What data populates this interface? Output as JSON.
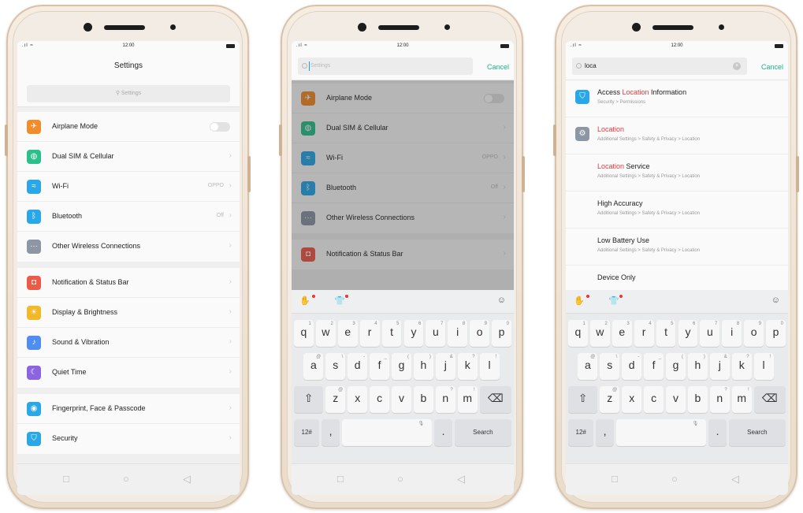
{
  "status": {
    "time": "12:00",
    "signal": ".ıl ≈"
  },
  "screen1": {
    "title": "Settings",
    "search_placeholder": "Settings",
    "groups": [
      [
        {
          "label": "Airplane Mode",
          "icon": "airplane-icon",
          "color": "#f08c2c",
          "glyph": "✈",
          "value": "",
          "control": "toggle"
        },
        {
          "label": "Dual SIM & Cellular",
          "icon": "globe-icon",
          "color": "#2bc08a",
          "glyph": "◍",
          "value": "",
          "control": "chevron"
        },
        {
          "label": "Wi-Fi",
          "icon": "wifi-icon",
          "color": "#2aa7e6",
          "glyph": "≈",
          "value": "OPPO",
          "control": "chevron"
        },
        {
          "label": "Bluetooth",
          "icon": "bluetooth-icon",
          "color": "#2aa7e6",
          "glyph": "ᛒ",
          "value": "Off",
          "control": "chevron"
        },
        {
          "label": "Other Wireless Connections",
          "icon": "more-icon",
          "color": "#8d96a3",
          "glyph": "···",
          "value": "",
          "control": "chevron"
        }
      ],
      [
        {
          "label": "Notification & Status Bar",
          "icon": "notification-icon",
          "color": "#ec5a48",
          "glyph": "◘",
          "value": "",
          "control": "chevron"
        },
        {
          "label": "Display & Brightness",
          "icon": "brightness-icon",
          "color": "#f2b827",
          "glyph": "☀",
          "value": "",
          "control": "chevron"
        },
        {
          "label": "Sound & Vibration",
          "icon": "sound-icon",
          "color": "#4f8ef0",
          "glyph": "♪",
          "value": "",
          "control": "chevron"
        },
        {
          "label": "Quiet Time",
          "icon": "moon-icon",
          "color": "#8c63e0",
          "glyph": "☾",
          "value": "",
          "control": "chevron"
        }
      ],
      [
        {
          "label": "Fingerprint, Face & Passcode",
          "icon": "fingerprint-icon",
          "color": "#2aa7e6",
          "glyph": "◉",
          "value": "",
          "control": "chevron"
        },
        {
          "label": "Security",
          "icon": "shield-icon",
          "color": "#2aa7e6",
          "glyph": "⛉",
          "value": "",
          "control": "chevron"
        }
      ]
    ]
  },
  "screen2": {
    "search_placeholder": "Settings",
    "cancel": "Cancel",
    "groups": [
      [
        {
          "label": "Airplane Mode",
          "icon": "airplane-icon",
          "color": "#f08c2c",
          "glyph": "✈",
          "value": "",
          "control": "toggle"
        },
        {
          "label": "Dual SIM & Cellular",
          "icon": "globe-icon",
          "color": "#2bc08a",
          "glyph": "◍",
          "value": "",
          "control": "chevron"
        },
        {
          "label": "Wi-Fi",
          "icon": "wifi-icon",
          "color": "#2aa7e6",
          "glyph": "≈",
          "value": "OPPO",
          "control": "chevron"
        },
        {
          "label": "Bluetooth",
          "icon": "bluetooth-icon",
          "color": "#2aa7e6",
          "glyph": "ᛒ",
          "value": "Off",
          "control": "chevron"
        },
        {
          "label": "Other Wireless Connections",
          "icon": "more-icon",
          "color": "#8d96a3",
          "glyph": "···",
          "value": "",
          "control": "chevron"
        }
      ],
      [
        {
          "label": "Notification & Status Bar",
          "icon": "notification-icon",
          "color": "#ec5a48",
          "glyph": "◘",
          "value": "",
          "control": "chevron"
        }
      ]
    ]
  },
  "screen3": {
    "query": "loca",
    "cancel": "Cancel",
    "results": [
      {
        "pre": "Access ",
        "hl": "Location",
        "post": " Information",
        "path": "Security > Permissions",
        "icon": "shield-icon",
        "color": "#2aa7e6",
        "glyph": "⛉"
      },
      {
        "pre": "",
        "hl": "Location",
        "post": "",
        "path": "Additional Settings > Safety & Privacy > Location",
        "icon": "gear-icon",
        "color": "#8d96a3",
        "glyph": "⚙"
      },
      {
        "pre": "",
        "hl": "Location",
        "post": " Service",
        "path": "Additional Settings > Safety & Privacy > Location",
        "icon": "",
        "color": "",
        "glyph": ""
      },
      {
        "pre": "High Accuracy",
        "hl": "",
        "post": "",
        "path": "Additional Settings > Safety & Privacy > Location",
        "icon": "",
        "color": "",
        "glyph": ""
      },
      {
        "pre": "Low Battery Use",
        "hl": "",
        "post": "",
        "path": "Additional Settings > Safety & Privacy > Location",
        "icon": "",
        "color": "",
        "glyph": ""
      },
      {
        "pre": "Device Only",
        "hl": "",
        "post": "",
        "path": "",
        "icon": "",
        "color": "",
        "glyph": ""
      }
    ]
  },
  "keyboard": {
    "row1": [
      [
        "q",
        "1"
      ],
      [
        "w",
        "2"
      ],
      [
        "e",
        "3"
      ],
      [
        "r",
        "4"
      ],
      [
        "t",
        "5"
      ],
      [
        "y",
        "6"
      ],
      [
        "u",
        "7"
      ],
      [
        "i",
        "8"
      ],
      [
        "o",
        "9"
      ],
      [
        "p",
        "0"
      ]
    ],
    "row2": [
      [
        "a",
        "@"
      ],
      [
        "s",
        "\\"
      ],
      [
        "d",
        "-"
      ],
      [
        "f",
        "_"
      ],
      [
        "g",
        "("
      ],
      [
        "h",
        ")"
      ],
      [
        "j",
        "&"
      ],
      [
        "k",
        "?"
      ],
      [
        "l",
        "!"
      ]
    ],
    "row3": [
      [
        "z",
        "@"
      ],
      [
        "x",
        ""
      ],
      [
        "c",
        ""
      ],
      [
        "v",
        ""
      ],
      [
        "b",
        ""
      ],
      [
        "n",
        "?"
      ],
      [
        "m",
        "!"
      ]
    ],
    "numbers_key": "12#",
    "search_key": "Search",
    "period_key": "."
  }
}
